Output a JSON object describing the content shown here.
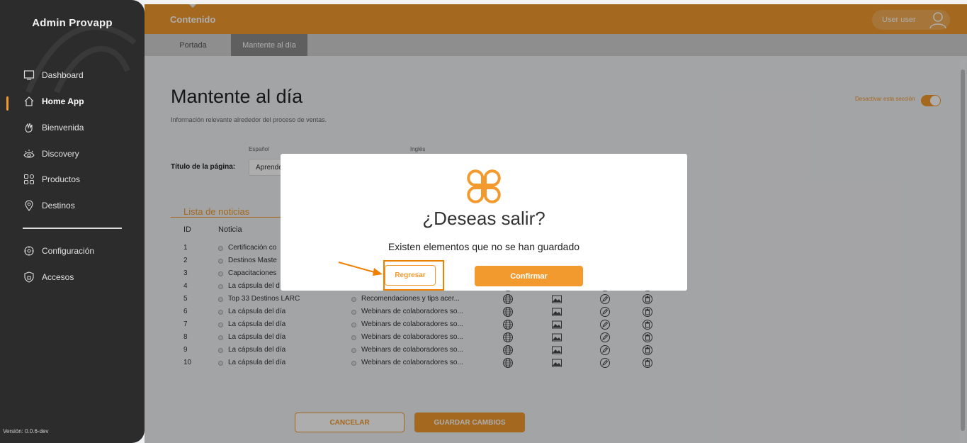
{
  "sidebar": {
    "brand": "Admin Provapp",
    "items": [
      {
        "label": "Dashboard",
        "icon": "monitor-icon"
      },
      {
        "label": "Home App",
        "icon": "home-icon",
        "active": true
      },
      {
        "label": "Bienvenida",
        "icon": "wave-hand-icon"
      },
      {
        "label": "Discovery",
        "icon": "eye-icon"
      },
      {
        "label": "Productos",
        "icon": "grid-icon"
      },
      {
        "label": "Destinos",
        "icon": "map-pin-icon"
      },
      {
        "label": "Configuración",
        "icon": "gear-icon"
      },
      {
        "label": "Accesos",
        "icon": "shield-icon"
      }
    ],
    "version": "Versión: 0.0.6-dev"
  },
  "header": {
    "title": "Contenido",
    "user_label": "User user"
  },
  "tabs": [
    {
      "label": "Portada",
      "active": false
    },
    {
      "label": "Mantente al día",
      "active": true
    }
  ],
  "main": {
    "title": "Mantente al día",
    "subtitle": "Información relevante alrededor del proceso de ventas.",
    "toggle_label": "Desactivar esta sección",
    "toggle_on": true,
    "lang_es": "Español",
    "lang_en": "Inglés",
    "field_label": "Título de la página:",
    "field_es_value": "Aprende",
    "list_title": "Lista de noticias",
    "col_id": "ID",
    "col_noticia": "Noticia",
    "rows": [
      {
        "id": "1",
        "c1": "Certificación co",
        "c2": ""
      },
      {
        "id": "2",
        "c1": "Destinos Maste",
        "c2": ""
      },
      {
        "id": "3",
        "c1": "Capacitaciones",
        "c2": ""
      },
      {
        "id": "4",
        "c1": "La cápsula del d",
        "c2": ""
      },
      {
        "id": "5",
        "c1": "Top 33 Destinos LARC",
        "c2": "Recomendaciones y tips acer..."
      },
      {
        "id": "6",
        "c1": "La cápsula del día",
        "c2": "Webinars de colaboradores so..."
      },
      {
        "id": "7",
        "c1": "La cápsula del día",
        "c2": "Webinars de colaboradores so..."
      },
      {
        "id": "8",
        "c1": "La cápsula del día",
        "c2": "Webinars de colaboradores so..."
      },
      {
        "id": "9",
        "c1": "La cápsula del día",
        "c2": "Webinars de colaboradores so..."
      },
      {
        "id": "10",
        "c1": "La cápsula del día",
        "c2": "Webinars de colaboradores so..."
      }
    ],
    "cancel_label": "CANCELAR",
    "save_label": "GUARDAR CAMBIOS"
  },
  "modal": {
    "title": "¿Deseas salir?",
    "message": "Existen elementos que no se han guardado",
    "back_label": "Regresar",
    "confirm_label": "Confirmar"
  },
  "colors": {
    "accent": "#f29a2e",
    "sidebar": "#2c2c2c"
  }
}
